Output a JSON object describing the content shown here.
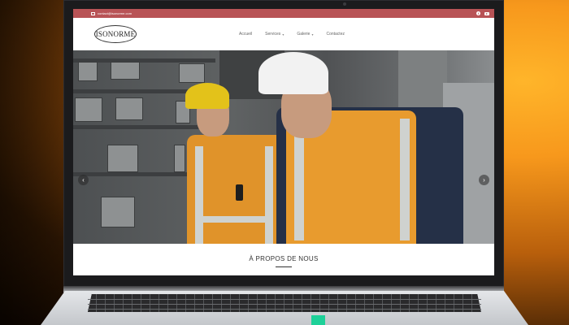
{
  "topbar": {
    "email": "contact@isonorme.com",
    "color": "#b85356"
  },
  "navbar": {
    "logo_text": "ISONORME",
    "menu": [
      {
        "label": "Accueil",
        "has_dropdown": false
      },
      {
        "label": "Services",
        "has_dropdown": true
      },
      {
        "label": "Galerie",
        "has_dropdown": true
      },
      {
        "label": "Contactez",
        "has_dropdown": false
      }
    ]
  },
  "hero": {
    "prev_label": "‹",
    "next_label": "›"
  },
  "about": {
    "title": "À PROPOS DE NOUS"
  },
  "icons": {
    "email": "envelope-icon",
    "facebook": "facebook-icon",
    "youtube": "youtube-icon",
    "caret": "chevron-down-icon"
  }
}
